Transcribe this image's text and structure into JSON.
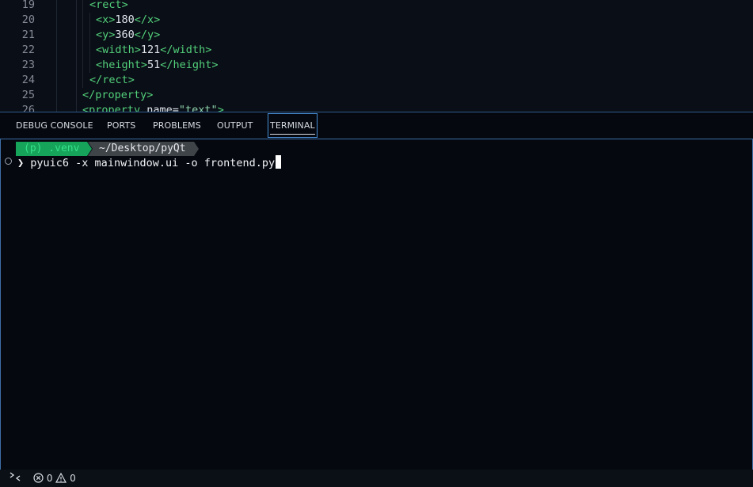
{
  "editor": {
    "lines": [
      {
        "num": "19",
        "indent": 113,
        "parts": [
          {
            "t": "<",
            "c": "tag"
          },
          {
            "t": "rect",
            "c": "tag"
          },
          {
            "t": ">",
            "c": "tag"
          }
        ]
      },
      {
        "num": "20",
        "indent": 121,
        "parts": [
          {
            "t": "<x>",
            "c": "tag"
          },
          {
            "t": "180",
            "c": "txt"
          },
          {
            "t": "</x>",
            "c": "tag"
          }
        ]
      },
      {
        "num": "21",
        "indent": 121,
        "parts": [
          {
            "t": "<y>",
            "c": "tag"
          },
          {
            "t": "360",
            "c": "txt"
          },
          {
            "t": "</y>",
            "c": "tag"
          }
        ]
      },
      {
        "num": "22",
        "indent": 121,
        "parts": [
          {
            "t": "<width>",
            "c": "tag"
          },
          {
            "t": "121",
            "c": "txt"
          },
          {
            "t": "</width>",
            "c": "tag"
          }
        ]
      },
      {
        "num": "23",
        "indent": 121,
        "parts": [
          {
            "t": "<height>",
            "c": "tag"
          },
          {
            "t": "51",
            "c": "txt"
          },
          {
            "t": "</height>",
            "c": "tag"
          }
        ]
      },
      {
        "num": "24",
        "indent": 113,
        "parts": [
          {
            "t": "</rect>",
            "c": "tag"
          }
        ]
      },
      {
        "num": "25",
        "indent": 104,
        "parts": [
          {
            "t": "</property>",
            "c": "tag"
          }
        ]
      },
      {
        "num": "26",
        "indent": 104,
        "parts": [
          {
            "t": "<property ",
            "c": "tag"
          },
          {
            "t": "name=",
            "c": "txt"
          },
          {
            "t": "\"text\"",
            "c": "str"
          },
          {
            "t": ">",
            "c": "tag"
          }
        ]
      }
    ]
  },
  "panel": {
    "tabs": [
      {
        "id": "debug-console",
        "label": "DEBUG CONSOLE",
        "active": false
      },
      {
        "id": "ports",
        "label": "PORTS",
        "active": false
      },
      {
        "id": "problems",
        "label": "PROBLEMS",
        "active": false
      },
      {
        "id": "output",
        "label": "OUTPUT",
        "active": false
      },
      {
        "id": "terminal",
        "label": "TERMINAL",
        "active": true
      }
    ]
  },
  "terminal": {
    "prompt_venv": "(p) .venv",
    "prompt_path": "~/Desktop/pyQt",
    "prompt_symbol": "❯",
    "command": "pyuic6 -x mainwindow.ui -o frontend.py"
  },
  "statusbar": {
    "remote_icon": "remote-icon",
    "errors": "0",
    "warnings": "0"
  },
  "colors": {
    "accent": "#4a8fd6",
    "tag": "#52d07b",
    "venv_bg": "#15a45a",
    "path_bg": "#3f4449"
  }
}
